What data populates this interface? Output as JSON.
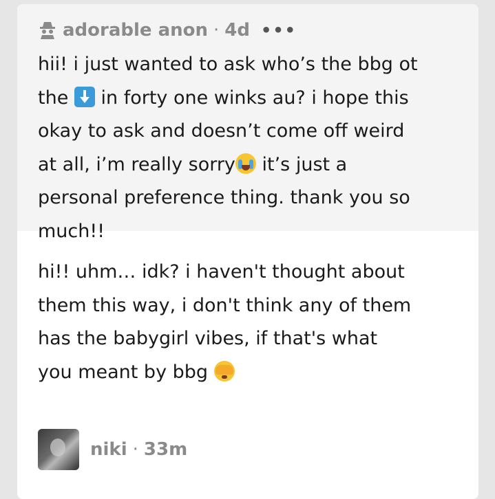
{
  "ask": {
    "asker": "adorable anon",
    "separator": "·",
    "time": "4d",
    "more": "•••",
    "question_lines": [
      "hii! i just wanted to ask who’s the bbg ot",
      "in forty one winks au? i hope this",
      "okay to ask and doesn’t come off weird",
      "at all, i’m really sorry",
      "it’s just a",
      "personal preference thing. thank you so",
      "much!!"
    ],
    "the_word": "the"
  },
  "answer": {
    "lines": [
      "hi!! uhm… idk? i haven't thought about",
      "them this way, i don't think any of them",
      "has the babygirl vibes, if that's what",
      "you meant by bbg"
    ]
  },
  "author": {
    "name": "niki",
    "separator": "·",
    "time": "33m"
  }
}
